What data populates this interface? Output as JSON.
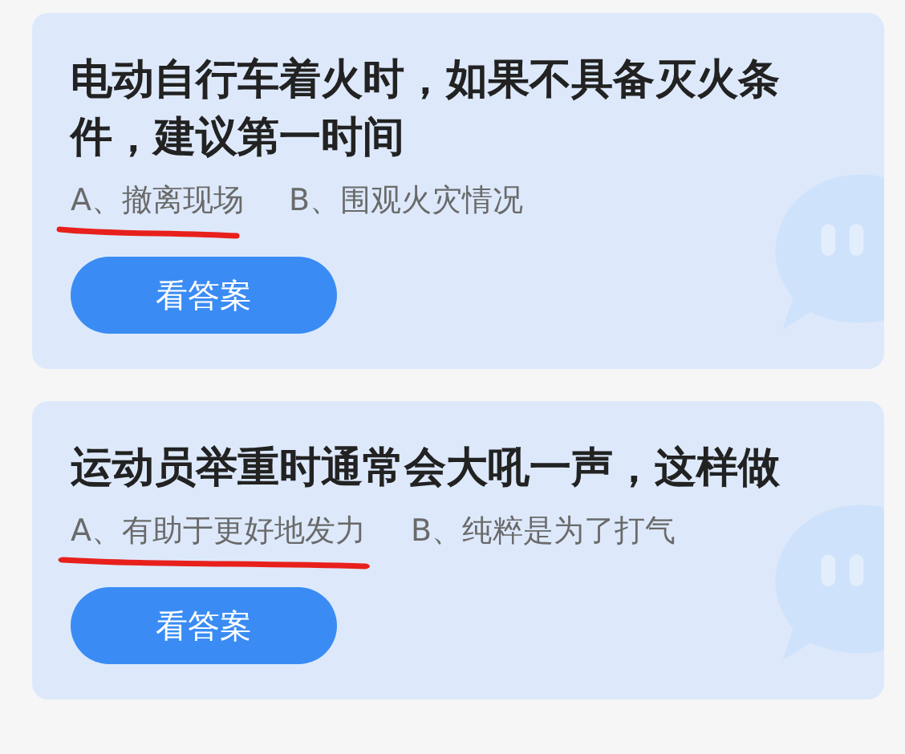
{
  "questions": [
    {
      "text": "电动自行车着火时，如果不具备灭火条件，建议第一时间",
      "options": [
        {
          "text": "A、撤离现场",
          "marked": true
        },
        {
          "text": "B、围观火灾情况",
          "marked": false
        }
      ],
      "button": "看答案"
    },
    {
      "text": "运动员举重时通常会大吼一声，这样做",
      "options": [
        {
          "text": "A、有助于更好地发力",
          "marked": true
        },
        {
          "text": "B、纯粹是为了打气",
          "marked": false
        }
      ],
      "button": "看答案"
    }
  ]
}
